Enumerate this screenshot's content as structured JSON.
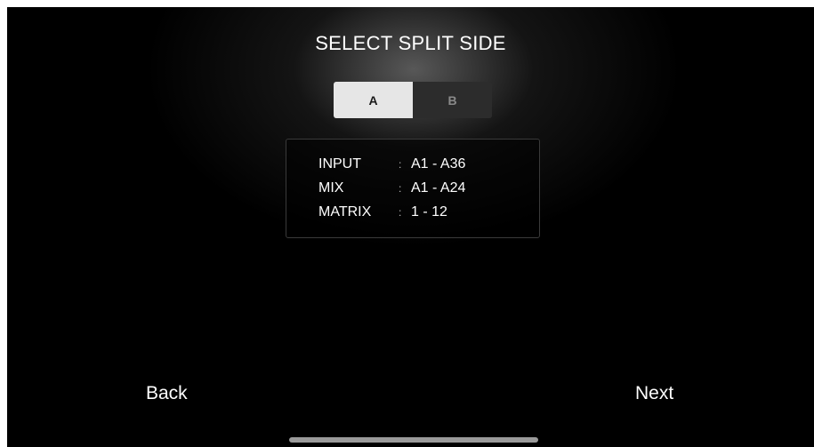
{
  "screen": {
    "title": "SELECT SPLIT SIDE"
  },
  "split_selector": {
    "options": [
      {
        "label": "A",
        "selected": true
      },
      {
        "label": "B",
        "selected": false
      }
    ]
  },
  "info": {
    "rows": [
      {
        "key": "INPUT",
        "separator": ":",
        "value": "A1 - A36"
      },
      {
        "key": "MIX",
        "separator": ":",
        "value": "A1 - A24"
      },
      {
        "key": "MATRIX",
        "separator": ":",
        "value": "1 - 12"
      }
    ]
  },
  "navigation": {
    "back_label": "Back",
    "next_label": "Next"
  },
  "colors": {
    "background": "#000000",
    "selected_segment": "#e6e6e6",
    "unselected_segment": "#2c2c2c",
    "text": "#ffffff",
    "home_indicator": "#9a9a9a"
  }
}
